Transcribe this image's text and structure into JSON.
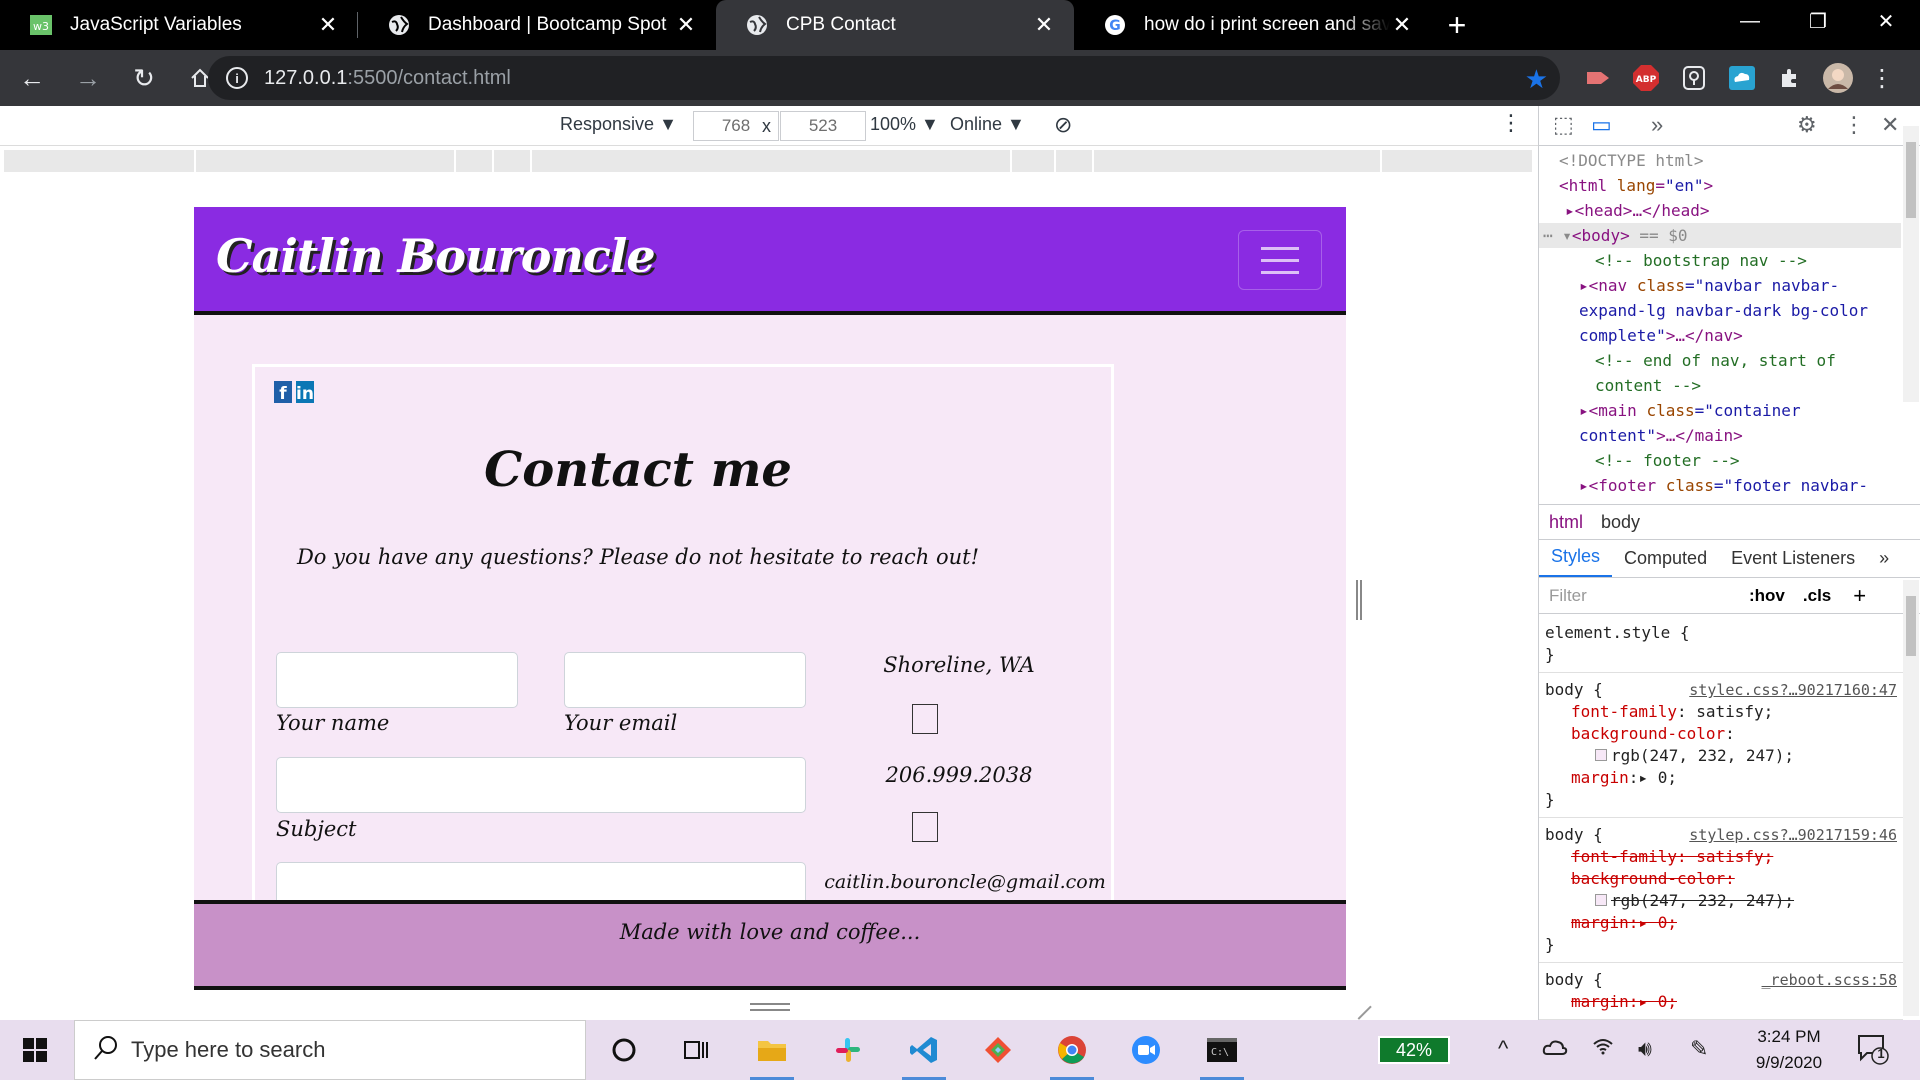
{
  "browser": {
    "tabs": [
      {
        "title": "JavaScript Variables",
        "favicon": "w3schools-icon"
      },
      {
        "title": "Dashboard | Bootcamp Spot",
        "favicon": "globe-icon"
      },
      {
        "title": "CPB Contact",
        "favicon": "globe-icon"
      },
      {
        "title": "how do i print screen and save to",
        "favicon": "google-icon"
      }
    ],
    "url_host": "127.0.0.1",
    "url_path": ":5500/contact.html",
    "extensions": {
      "abp_label": "ABP"
    }
  },
  "device_toolbar": {
    "mode": "Responsive",
    "width": "768",
    "times": "x",
    "height": "523",
    "zoom": "100%",
    "network": "Online"
  },
  "site": {
    "brand": "Caitlin Bouroncle",
    "title": "Contact me",
    "subtitle": "Do you have any questions? Please do not hesitate to reach out!",
    "label_name": "Your name",
    "label_email": "Your email",
    "label_subject": "Subject",
    "location": "Shoreline, WA",
    "phone": "206.999.2038",
    "email": "caitlin.bouroncle@gmail.com",
    "footer": "Made with love and coffee..."
  },
  "devtools": {
    "dom": {
      "doctype": "<!DOCTYPE html>",
      "html_open": "<html ",
      "html_lang_attr": "lang",
      "html_lang_val": "\"en\"",
      "html_close": ">",
      "head": "<head>…</head>",
      "body_open": "<body>",
      "body_eq": " == $0",
      "comment_nav": "<!-- bootstrap nav -->",
      "nav_tag": "<nav ",
      "nav_class_attr": "class",
      "nav_class_val_1": "=\"navbar navbar-",
      "nav_class_val_2": "expand-lg navbar-dark bg-color",
      "nav_class_val_3": "complete\"",
      "nav_end": ">…</nav>",
      "comment_end_nav_1": "<!-- end of nav, start of",
      "comment_end_nav_2": "content -->",
      "main_tag": "<main ",
      "main_class_attr": "class",
      "main_class_val_1": "=\"container",
      "main_class_val_2": "content\"",
      "main_end": ">…</main>",
      "comment_footer": "<!-- footer -->",
      "footer_tag": "<footer ",
      "footer_class_attr": "class",
      "footer_class_val": "=\"footer navbar-"
    },
    "breadcrumbs": [
      "html",
      "body"
    ],
    "panel_tabs": [
      "Styles",
      "Computed",
      "Event Listeners"
    ],
    "filter_placeholder": "Filter",
    "hov": ":hov",
    "cls": ".cls",
    "styles": {
      "element_style": "element.style {",
      "close": "}",
      "rule1_selector": "body {",
      "rule1_src": "stylec.css?…90217160:47",
      "rule1_p1_name": "font-family",
      "rule1_p1_val": ": satisfy;",
      "rule1_p2_name": "background-color",
      "rule1_p2_val": ":",
      "rule1_p2_color": "rgb(247, 232, 247);",
      "rule1_p3_name": "margin",
      "rule1_p3_val": ":▸ 0;",
      "rule2_selector": "body {",
      "rule2_src": "stylep.css?…90217159:46",
      "rule2_p1": "font-family: satisfy;",
      "rule2_p2": "background-color:",
      "rule2_p2_color": "rgb(247, 232, 247);",
      "rule2_p3": "margin:▸ 0;",
      "rule3_selector": "body {",
      "rule3_src": "_reboot.scss:58",
      "rule3_p1": "margin:▸ 0;"
    }
  },
  "taskbar": {
    "search_placeholder": "Type here to search",
    "battery": "42%",
    "time": "3:24 PM",
    "date": "9/9/2020",
    "notification_count": "1"
  },
  "colors": {
    "nav_purple": "#8a2be2",
    "page_bg": "#f7e8f7",
    "footer_pink": "#c891c8"
  }
}
